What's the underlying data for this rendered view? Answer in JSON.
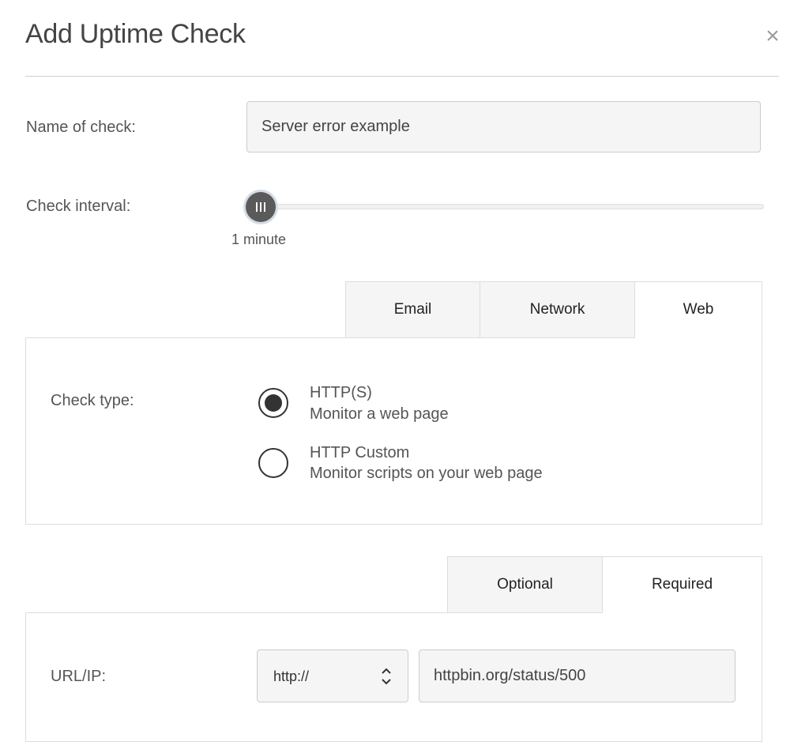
{
  "dialog": {
    "title": "Add Uptime Check",
    "close_label": "×"
  },
  "form": {
    "name": {
      "label": "Name of check:",
      "value": "Server error example"
    },
    "interval": {
      "label": "Check interval:",
      "value_text": "1 minute",
      "position": 0
    }
  },
  "category_tabs": [
    {
      "label": "Email",
      "active": false
    },
    {
      "label": "Network",
      "active": false
    },
    {
      "label": "Web",
      "active": true
    }
  ],
  "check_type": {
    "label": "Check type:",
    "options": [
      {
        "title": "HTTP(S)",
        "description": "Monitor a web page",
        "selected": true
      },
      {
        "title": "HTTP Custom",
        "description": "Monitor scripts on your web page",
        "selected": false
      }
    ]
  },
  "settings_tabs": [
    {
      "label": "Optional",
      "active": false
    },
    {
      "label": "Required",
      "active": true
    }
  ],
  "url": {
    "label": "URL/IP:",
    "protocol": "http://",
    "value": "httpbin.org/status/500"
  },
  "icons": {
    "close": "close-icon",
    "slider_grip": "grip-icon",
    "select_arrows": "sort-arrows-icon"
  }
}
